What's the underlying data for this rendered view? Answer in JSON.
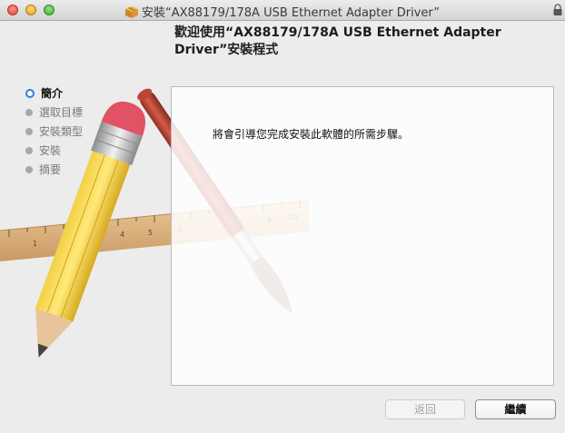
{
  "window": {
    "title": "安裝“AX88179/178A USB Ethernet Adapter Driver”",
    "header": "歡迎使用“AX88179/178A USB Ethernet Adapter Driver”安裝程式"
  },
  "sidebar": {
    "steps": [
      {
        "label": "簡介",
        "active": true
      },
      {
        "label": "選取目標",
        "active": false
      },
      {
        "label": "安裝類型",
        "active": false
      },
      {
        "label": "安裝",
        "active": false
      },
      {
        "label": "摘要",
        "active": false
      }
    ]
  },
  "content": {
    "text": "將會引導您完成安裝此軟體的所需步驟。"
  },
  "buttons": {
    "back_label": "返回",
    "continue_label": "繼續"
  },
  "ruler": {
    "tick_labels": [
      "1",
      "4",
      "5",
      "6",
      "9",
      "10"
    ]
  },
  "icons": [
    "package-icon",
    "lock-icon",
    "pencil-illustration",
    "ruler-illustration",
    "paintbrush-illustration"
  ]
}
